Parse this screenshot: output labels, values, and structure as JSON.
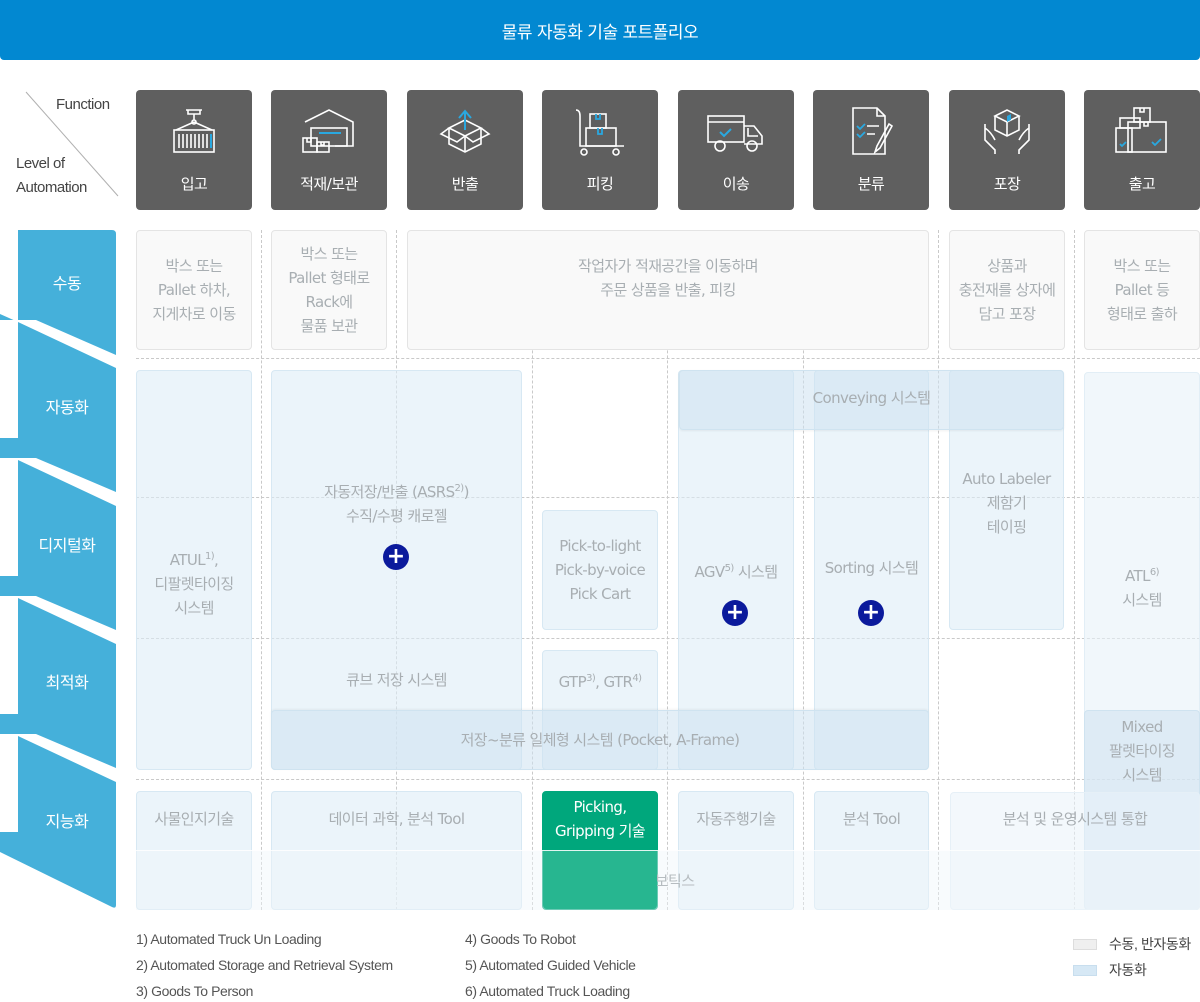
{
  "header": {
    "title": "물류 자동화 기술 포트폴리오"
  },
  "axis": {
    "function_label": "Function",
    "level_label_1": "Level of",
    "level_label_2": "Automation"
  },
  "functions": [
    {
      "label": "입고",
      "icon": "container-crane-icon"
    },
    {
      "label": "적재/보관",
      "icon": "warehouse-icon"
    },
    {
      "label": "반출",
      "icon": "box-out-icon"
    },
    {
      "label": "피킹",
      "icon": "hand-truck-icon"
    },
    {
      "label": "이송",
      "icon": "delivery-truck-icon"
    },
    {
      "label": "분류",
      "icon": "checklist-icon"
    },
    {
      "label": "포장",
      "icon": "hands-box-icon"
    },
    {
      "label": "출고",
      "icon": "boxes-icon"
    }
  ],
  "levels": [
    "수동",
    "자동화",
    "디지털화",
    "최적화",
    "지능화"
  ],
  "cells": {
    "manual_inbound": [
      "박스 또는",
      "Pallet 하차,",
      "지게차로 이동"
    ],
    "manual_storage": [
      "박스 또는",
      "Pallet 형태로",
      "Rack에",
      "물품 보관"
    ],
    "manual_picking": [
      "작업자가 적재공간을 이동하며",
      "주문 상품을 반출, 피킹"
    ],
    "manual_packing": [
      "상품과",
      "충전재를 상자에",
      "담고 포장"
    ],
    "manual_outbound": [
      "박스 또는",
      "Pallet 등",
      "형태로 출하"
    ],
    "atul": {
      "text": "ATUL",
      "sup": "1)",
      "suffix": ",",
      "line2": "디팔렛타이징",
      "line3": "시스템"
    },
    "asrs": {
      "line1a": "자동저장/반출 (ASRS",
      "sup": "2)",
      "line1b": ")",
      "line2": "수직/수평 캐로젤"
    },
    "conveying": "Conveying 시스템",
    "pick_to_light": [
      "Pick-to-light",
      "Pick-by-voice",
      "Pick Cart"
    ],
    "agv": {
      "text": "AGV",
      "sup": "5)",
      "suffix": " 시스템"
    },
    "sorting": "Sorting 시스템",
    "auto_labeler": [
      "Auto Labeler",
      "제함기",
      "테이핑"
    ],
    "atl": {
      "text": "ATL",
      "sup": "6)",
      "line2": "시스템"
    },
    "cube": "큐브 저장 시스템",
    "gtp_gtr": {
      "a": "GTP",
      "sup_a": "3)",
      "b": ", GTR",
      "sup_b": "4)"
    },
    "pocket": "저장~분류 일체형 시스템 (Pocket, A-Frame)",
    "mixed": [
      "Mixed",
      "팔렛타이징",
      "시스템"
    ],
    "iot": "사물인지기술",
    "data_science": "데이터 과학, 분석 Tool",
    "picking_gripping": [
      "Picking,",
      "Gripping 기술"
    ],
    "autonomous": "자동주행기술",
    "analysis_tool": "분석 Tool",
    "integration": "분석 및 운영시스템 통합",
    "robotics": "로보틱스",
    "plus": "+"
  },
  "footnotes": [
    "1) Automated Truck Un Loading",
    "2) Automated Storage and Retrieval System",
    "3) Goods To Person",
    "4) Goods To Robot",
    "5) Automated Guided Vehicle",
    "6) Automated Truck Loading"
  ],
  "legend": [
    {
      "label": "수동, 반자동화",
      "color": "#efefef"
    },
    {
      "label": "자동화",
      "color": "#d6e8f5"
    }
  ],
  "colors": {
    "header": "#0288d1",
    "sidebar": "#45b0da",
    "function_box": "#5f5f5f",
    "accent_icon": "#29a8e0",
    "plus_button": "#0b1a9c",
    "highlight": "#00a77c"
  }
}
